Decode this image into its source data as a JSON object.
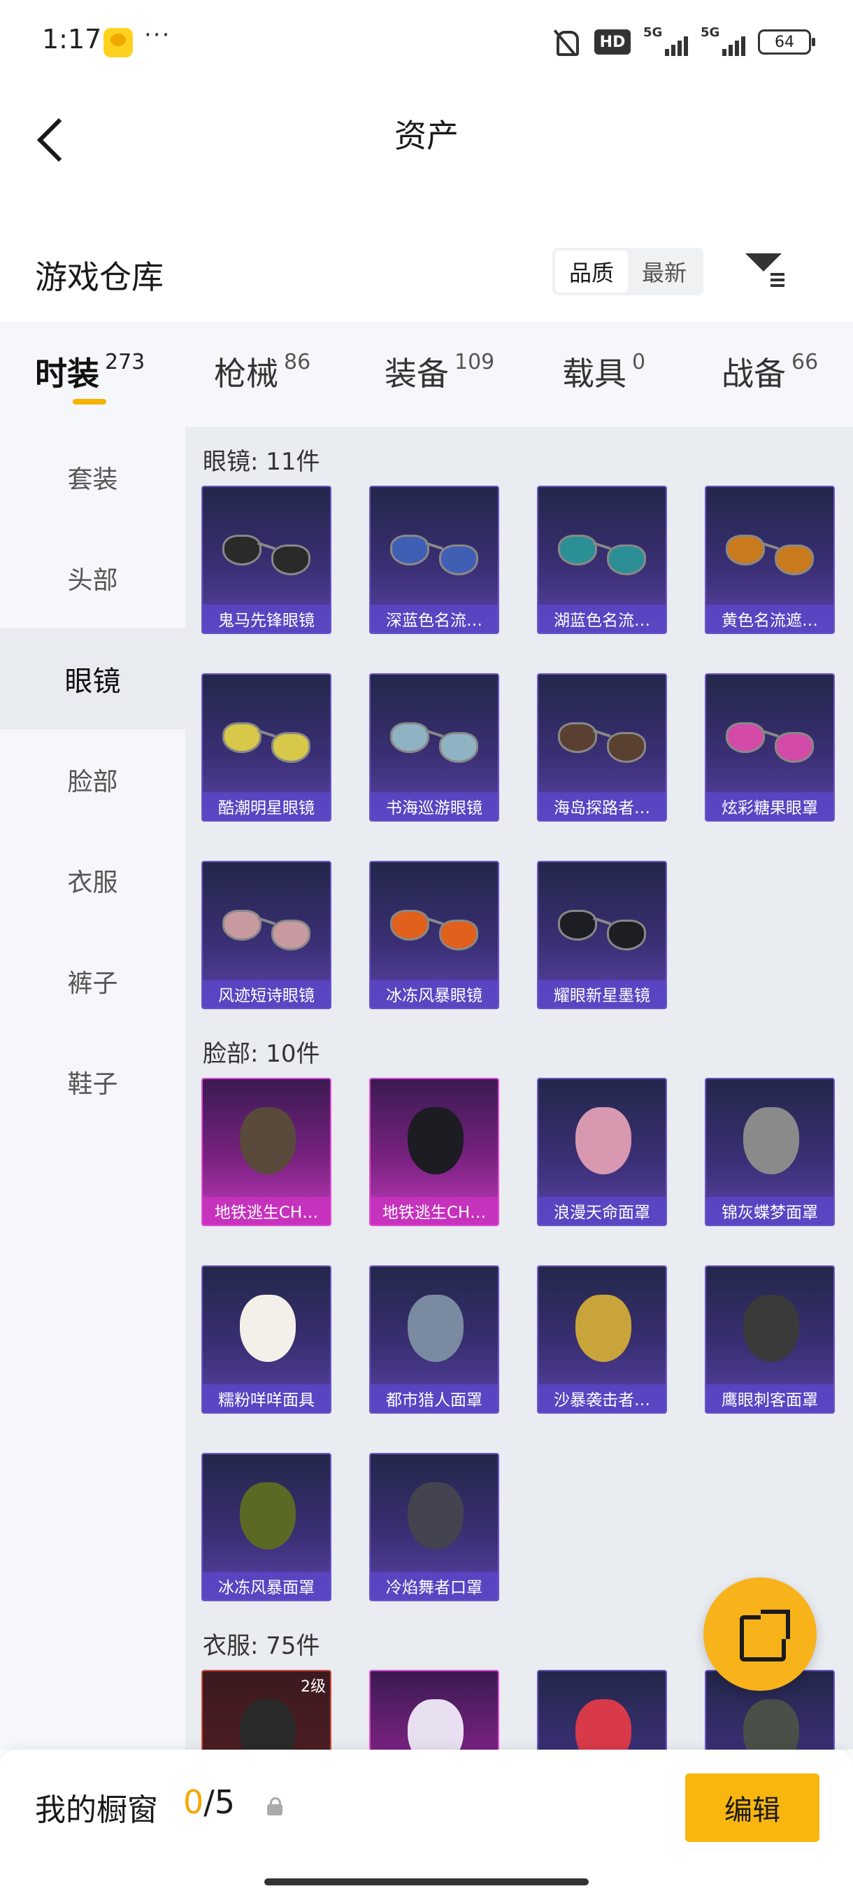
{
  "status_bar": {
    "time": "1:17",
    "dots": "···",
    "hd": "HD",
    "net1": "5G",
    "net2": "5G",
    "battery": "64"
  },
  "header": {
    "title": "资产"
  },
  "warehouse": {
    "title": "游戏仓库",
    "sort_options": [
      "品质",
      "最新"
    ],
    "sort_selected": "品质"
  },
  "category_tabs": [
    {
      "label": "时装",
      "count": "273",
      "active": true
    },
    {
      "label": "枪械",
      "count": "86"
    },
    {
      "label": "装备",
      "count": "109"
    },
    {
      "label": "载具",
      "count": "0"
    },
    {
      "label": "战备",
      "count": "66"
    }
  ],
  "sidebar": {
    "items": [
      "套装",
      "头部",
      "眼镜",
      "脸部",
      "衣服",
      "裤子",
      "鞋子"
    ],
    "selected": "眼镜"
  },
  "groups": {
    "glasses": {
      "title": "眼镜: 11件",
      "items": [
        {
          "name": "鬼马先锋眼镜",
          "lens_color": "#2a2a2a"
        },
        {
          "name": "深蓝色名流…",
          "lens_color": "#3f5fb5"
        },
        {
          "name": "湖蓝色名流…",
          "lens_color": "#2d8f96"
        },
        {
          "name": "黄色名流遮…",
          "lens_color": "#c87a1c"
        },
        {
          "name": "酷潮明星眼镜",
          "lens_color": "#d8c84a"
        },
        {
          "name": "书海巡游眼镜",
          "lens_color": "#8fb3c2"
        },
        {
          "name": "海岛探路者…",
          "lens_color": "#5a4030"
        },
        {
          "name": "炫彩糖果眼罩",
          "lens_color": "#d44aa8"
        },
        {
          "name": "风迹短诗眼镜",
          "lens_color": "#c89aa0"
        },
        {
          "name": "冰冻风暴眼镜",
          "lens_color": "#e0601c"
        },
        {
          "name": "耀眼新星墨镜",
          "lens_color": "#1d1d24"
        }
      ]
    },
    "face": {
      "title": "脸部: 10件",
      "items": [
        {
          "name": "地铁逃生CH…",
          "tint": "pink",
          "shape_color": "#5a4a3c"
        },
        {
          "name": "地铁逃生CH…",
          "tint": "pink",
          "shape_color": "#1c1c22"
        },
        {
          "name": "浪漫天命面罩",
          "shape_color": "#d898b0"
        },
        {
          "name": "锦灰蝶梦面罩",
          "shape_color": "#8a8a8a"
        },
        {
          "name": "糯粉咩咩面具",
          "shape_color": "#f4efe8"
        },
        {
          "name": "都市猎人面罩",
          "shape_color": "#7a8aa0"
        },
        {
          "name": "沙暴袭击者…",
          "shape_color": "#c8a43a"
        },
        {
          "name": "鹰眼刺客面罩",
          "shape_color": "#3a3a3a"
        },
        {
          "name": "冰冻风暴面罩",
          "shape_color": "#5a6a24"
        },
        {
          "name": "冷焰舞者口罩",
          "shape_color": "#444450"
        }
      ]
    },
    "clothes": {
      "title": "衣服: 75件",
      "items": [
        {
          "level": "2级",
          "tint": "red",
          "shape_color": "#2a2a2a"
        },
        {
          "tint": "pink",
          "shape_color": "#e8e0f0"
        },
        {
          "shape_color": "#d83a4a"
        },
        {
          "shape_color": "#4a5048"
        }
      ]
    }
  },
  "bottom_bar": {
    "label": "我的橱窗",
    "count_current": "0",
    "count_total": "/5",
    "edit_label": "编辑"
  }
}
